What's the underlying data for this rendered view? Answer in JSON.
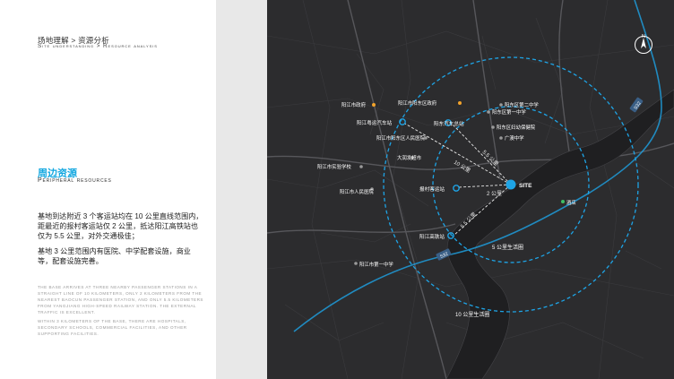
{
  "breadcrumb": {
    "cn": "场地理解 > 资源分析",
    "en": "Site understanding > Resource analysis"
  },
  "section": {
    "title_cn": "周边资源",
    "title_en": "Peripheral resources"
  },
  "paragraphs": [
    "基地到达附近 3 个客运站均在 10 公里直线范围内，距最近的报村客运站仅 2 公里，抵达阳江高铁站也仅为 5.5 公里，对外交通极佳；",
    "基地 3 公里范围内有医院、中学配套设施，商业等，配套设施完善。"
  ],
  "english_paragraphs": [
    "The base arrives at three nearby passenger stations in a straight line of 10 kilometers, only 2 kilometers from the nearest Baocun passenger station, and only 5.5 kilometers from Yangjiang high-speed railway station. The external traffic is excellent.",
    "Within 3 kilometers of the base, there are hospitals, secondary schools, commercial facilities, and other supporting facilities."
  ],
  "map": {
    "compass": "N",
    "site_label": "SITE",
    "highway_labels": [
      "S32",
      "S32"
    ],
    "ring_labels": [
      "5 公里生活圈",
      "10 公里生活圈"
    ],
    "distance_labels": [
      "5.5 公里",
      "10 公里",
      "2 公里",
      "5.5 公里"
    ],
    "stations": [
      "阳江粤运汽车站",
      "阳东汽车总站",
      "报村客运站",
      "阳江高铁站"
    ],
    "places": [
      "阳江市政府",
      "阳江市阳东区政府",
      "阳东区第二中学",
      "阳东区第一中学",
      "阳江市阳东区人民医院",
      "阳东区妇幼保健院",
      "广澳中学",
      "大润发超市",
      "阳江市实验学校",
      "阳江市人民医院",
      "酒店",
      "阳江市第一中学"
    ],
    "colors": {
      "accent": "#1ea4e6",
      "marker_orange": "#f2a32b",
      "marker_green": "#3fbf66",
      "map_bg": "#2c2c2e"
    }
  }
}
